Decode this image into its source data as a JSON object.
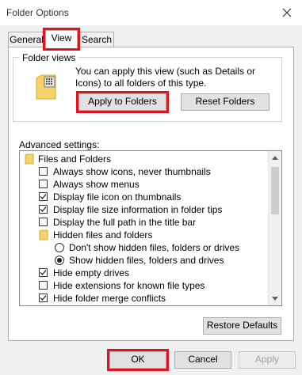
{
  "window": {
    "title": "Folder Options"
  },
  "tabs": [
    {
      "label": "General"
    },
    {
      "label": "View"
    },
    {
      "label": "Search"
    }
  ],
  "folder_views": {
    "label": "Folder views",
    "description": "You can apply this view (such as Details or Icons) to all folders of this type.",
    "apply_button": "Apply to Folders",
    "reset_button": "Reset Folders"
  },
  "advanced": {
    "label": "Advanced settings:",
    "items": [
      {
        "type": "folder",
        "label": "Files and Folders"
      },
      {
        "type": "checkbox",
        "label": "Always show icons, never thumbnails",
        "checked": false
      },
      {
        "type": "checkbox",
        "label": "Always show menus",
        "checked": false
      },
      {
        "type": "checkbox",
        "label": "Display file icon on thumbnails",
        "checked": true
      },
      {
        "type": "checkbox",
        "label": "Display file size information in folder tips",
        "checked": true
      },
      {
        "type": "checkbox",
        "label": "Display the full path in the title bar",
        "checked": false
      },
      {
        "type": "folder",
        "label": "Hidden files and folders"
      },
      {
        "type": "radio",
        "label": "Don't show hidden files, folders or drives",
        "checked": false
      },
      {
        "type": "radio",
        "label": "Show hidden files, folders and drives",
        "checked": true
      },
      {
        "type": "checkbox",
        "label": "Hide empty drives",
        "checked": true
      },
      {
        "type": "checkbox",
        "label": "Hide extensions for known file types",
        "checked": false
      },
      {
        "type": "checkbox",
        "label": "Hide folder merge conflicts",
        "checked": true
      }
    ]
  },
  "restore_button": "Restore Defaults",
  "footer": {
    "ok": "OK",
    "cancel": "Cancel",
    "apply": "Apply"
  },
  "colors": {
    "highlight": "#e0141e",
    "disabled_text": "#a0a0a0",
    "folder": "#f5c542"
  }
}
